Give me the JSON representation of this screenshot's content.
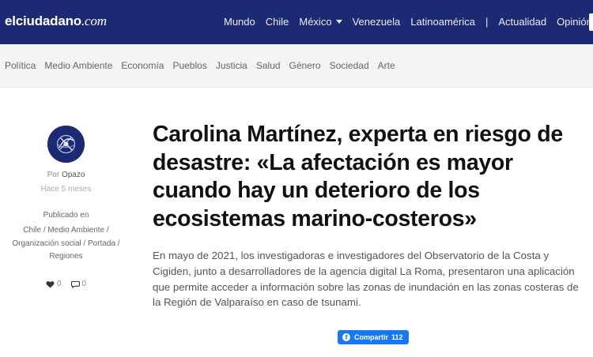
{
  "site": {
    "brand": "elciudadano",
    "tld": ".com"
  },
  "topnav": {
    "items": [
      {
        "label": "Mundo"
      },
      {
        "label": "Chile"
      },
      {
        "label": "México",
        "has_dropdown": true
      },
      {
        "label": "Venezuela"
      },
      {
        "label": "Latinoamérica"
      },
      {
        "label": "|",
        "separator": true
      },
      {
        "label": "Actualidad"
      },
      {
        "label": "Opinión"
      }
    ]
  },
  "categories": [
    "Política",
    "Medio Ambiente",
    "Economía",
    "Pueblos",
    "Justicia",
    "Salud",
    "Género",
    "Sociedad",
    "Arte"
  ],
  "meta": {
    "by_prefix": "Por",
    "author": "Opazo",
    "time_ago": "Hace 5 meses",
    "published_label": "Publicado en",
    "published_cats": [
      "Chile",
      "Medio Ambiente",
      "Organización social",
      "Portada",
      "Regiones"
    ],
    "likes": "0",
    "comments": "0"
  },
  "article": {
    "title": "Carolina Martínez, experta en riesgo de desastre: «La afectación es mayor cuando hay un deterioro de los ecosistemas marino-costeros»",
    "lead": "En mayo de 2021, los investigadoras e investigadores del Observatorio de la Costa y Cigiden, junto a desarrolladores de la agencia digital La Roma, presentaron una aplicación que permite acceder a información sobre las zonas de inundación en las zonas costeras de la Región de Valparaíso en caso de tsunami."
  },
  "share": {
    "label": "Compartir",
    "count": "112"
  },
  "colors": {
    "nav_bg": "#1c2a73",
    "facebook": "#1877f2"
  },
  "icons": [
    "heart-icon",
    "comment-icon",
    "facebook-icon",
    "chevron-down-icon"
  ]
}
